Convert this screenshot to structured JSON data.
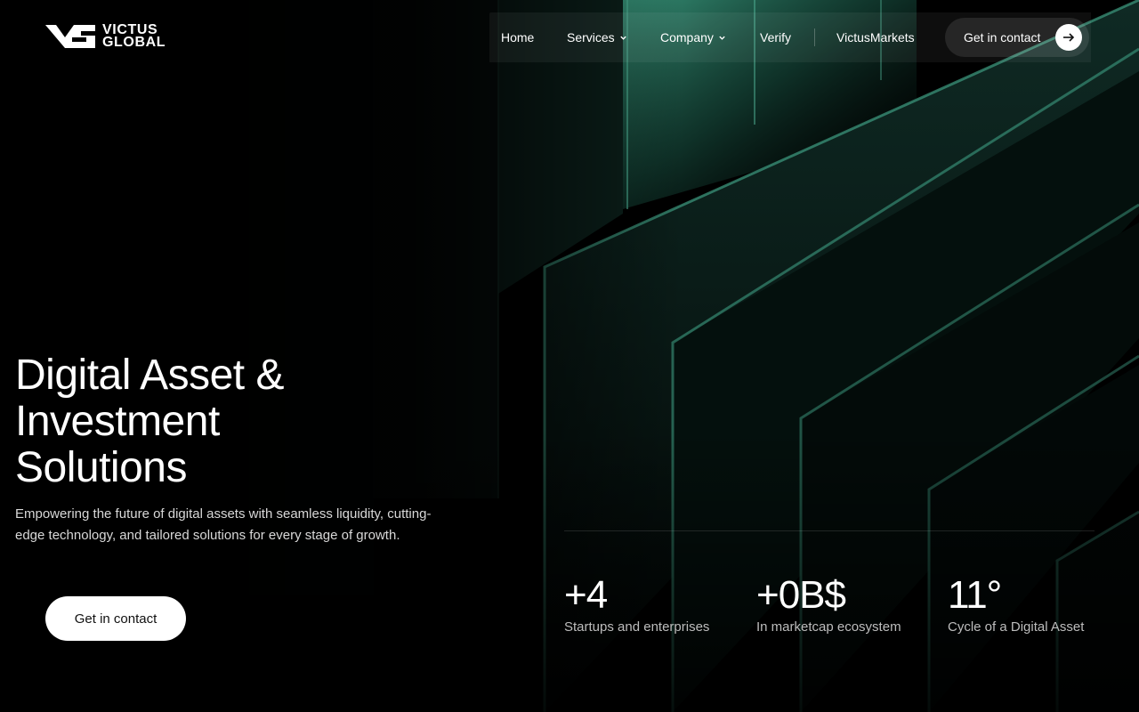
{
  "brand": {
    "line1": "VICTUS",
    "line2": "GLOBAL"
  },
  "nav": {
    "home": "Home",
    "services": "Services",
    "company": "Company",
    "verify": "Verify",
    "markets": "VictusMarkets",
    "cta": "Get in contact"
  },
  "hero": {
    "title_line1": "Digital Asset &",
    "title_line2": "Investment",
    "title_line3": "Solutions",
    "subtitle": "Empowering the future of digital assets with seamless liquidity, cutting-edge technology, and tailored solutions for every stage of growth.",
    "cta": "Get in contact"
  },
  "stats": [
    {
      "value": "+4",
      "label": "Startups and enterprises"
    },
    {
      "value": "+0B$",
      "label": "In marketcap ecosystem"
    },
    {
      "value": "11°",
      "label": "Cycle of a Digital Asset"
    }
  ],
  "colors": {
    "background": "#000000",
    "accent_green": "#2f8f74",
    "text": "#ffffff",
    "muted": "#bdbdbd"
  },
  "icons": {
    "logo": "victus-logo-icon",
    "dropdown": "chevron-down-icon",
    "arrow": "arrow-right-icon"
  }
}
